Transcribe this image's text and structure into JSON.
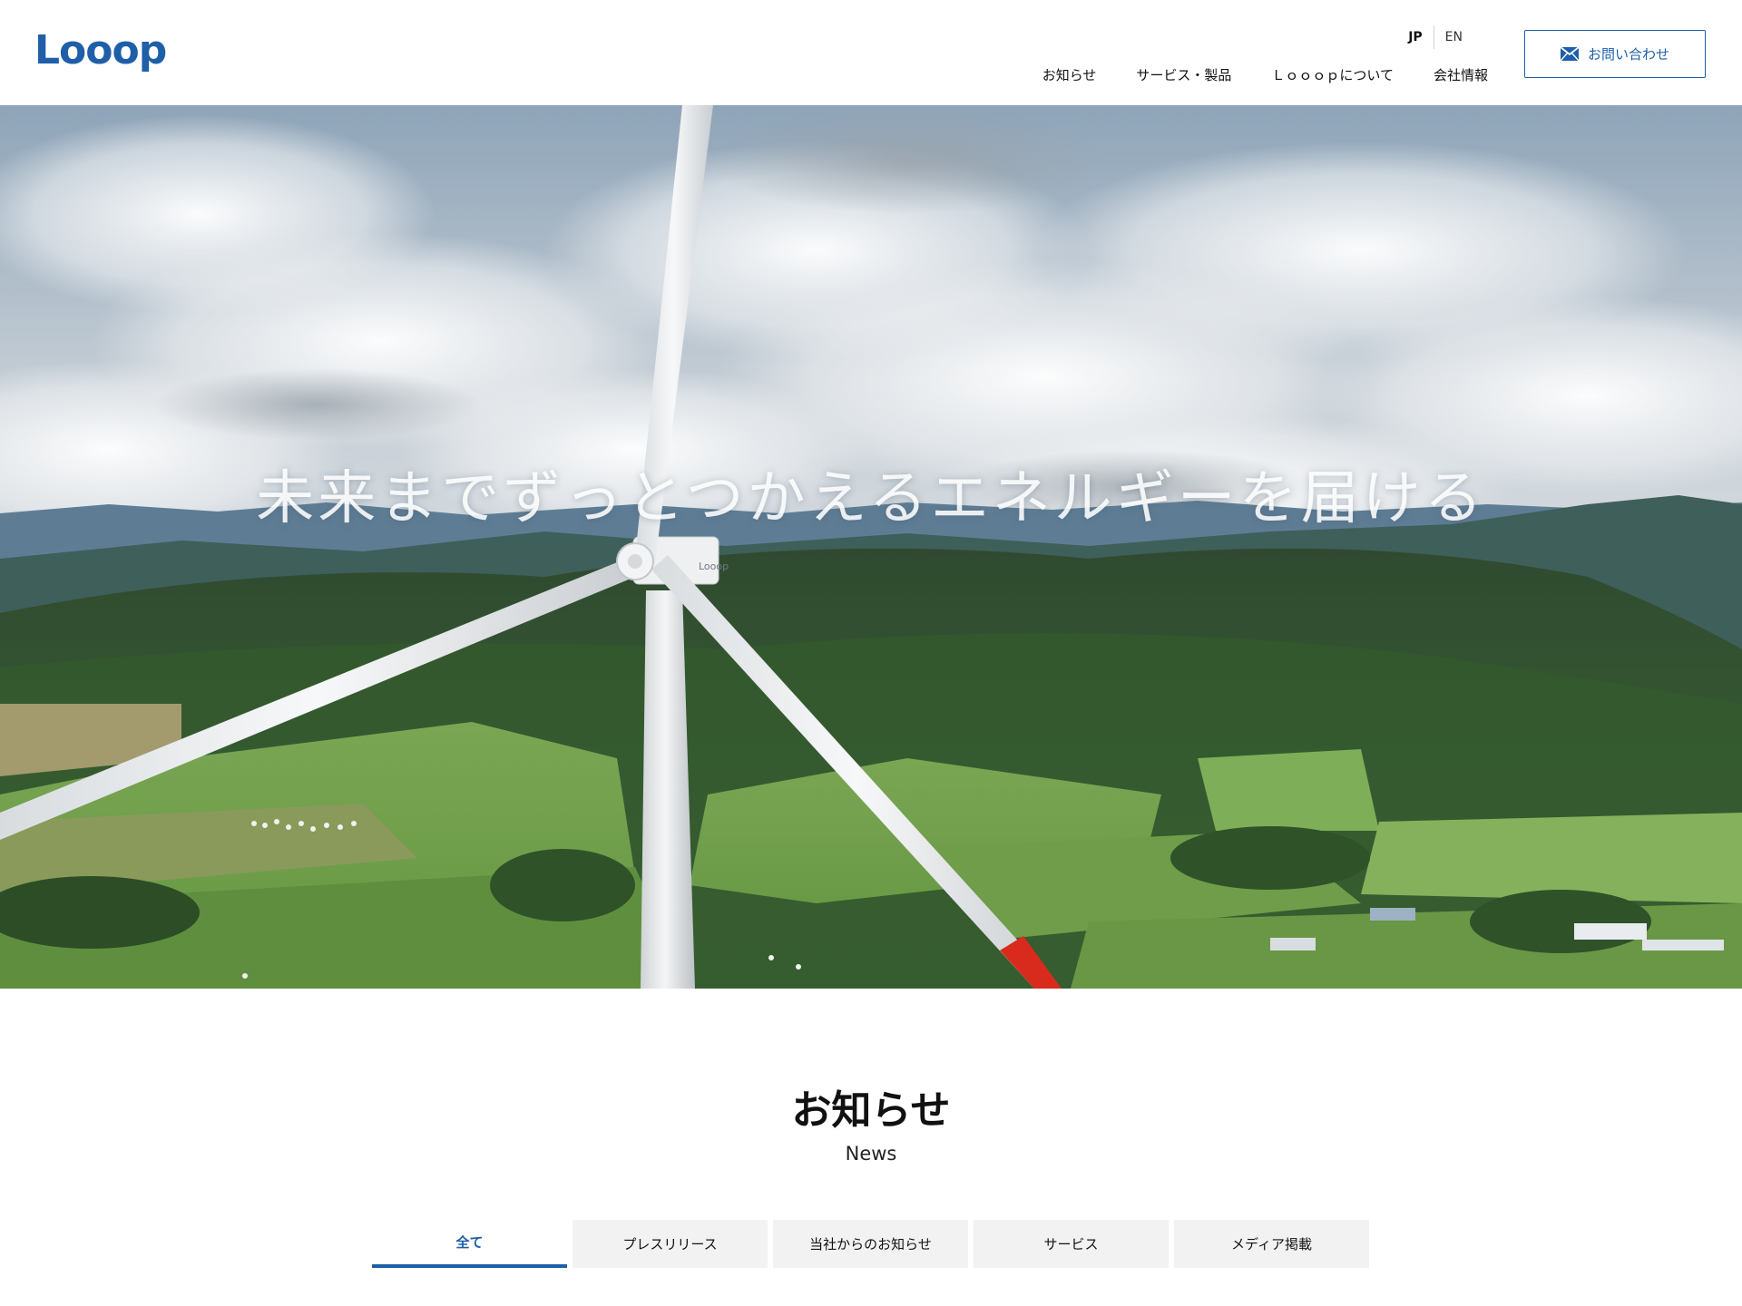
{
  "header": {
    "logo": "Looop",
    "languages": [
      {
        "label": "JP",
        "active": true
      },
      {
        "label": "EN",
        "active": false
      }
    ],
    "nav": [
      {
        "label": "お知らせ"
      },
      {
        "label": "サービス・製品"
      },
      {
        "label": "Ｌｏｏｏｐについて"
      },
      {
        "label": "会社情報"
      }
    ],
    "contact_label": "お問い合わせ"
  },
  "hero": {
    "copy": "未来までずっとつかえるエネルギーを届ける",
    "turbine_label": "Looop"
  },
  "news": {
    "title": "お知らせ",
    "subtitle": "News",
    "tabs": [
      {
        "label": "全て",
        "active": true
      },
      {
        "label": "プレスリリース",
        "active": false
      },
      {
        "label": "当社からのお知らせ",
        "active": false
      },
      {
        "label": "サービス",
        "active": false
      },
      {
        "label": "メディア掲載",
        "active": false
      }
    ]
  },
  "colors": {
    "brand": "#1e5fa8",
    "tab_bg": "#f2f2f2"
  }
}
